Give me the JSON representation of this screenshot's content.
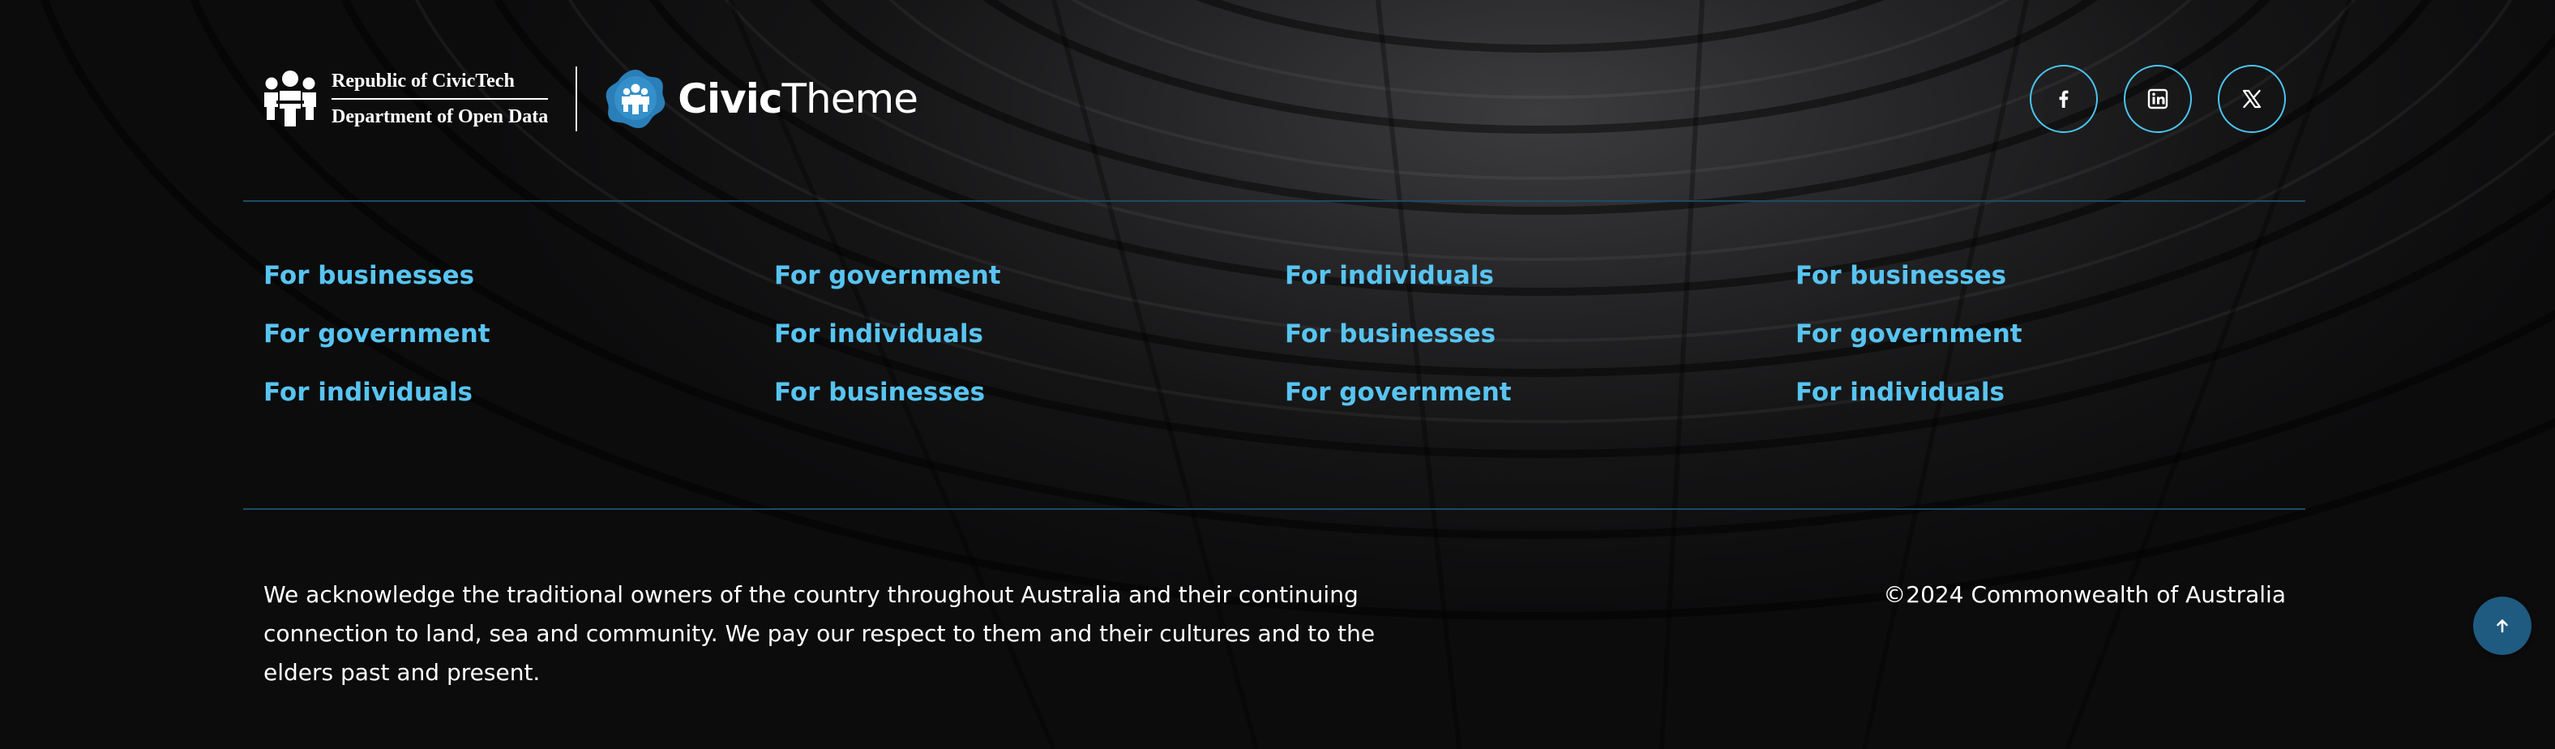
{
  "brand": {
    "gov_line1": "Republic of CivicTech",
    "gov_line2": "Department of Open Data",
    "civic_bold": "Civic",
    "civic_light": "Theme"
  },
  "social": [
    {
      "icon": "facebook-icon"
    },
    {
      "icon": "linkedin-icon"
    },
    {
      "icon": "x-twitter-icon"
    }
  ],
  "nav": {
    "col1": [
      "For businesses",
      "For government",
      "For individuals"
    ],
    "col2": [
      "For government",
      "For individuals",
      "For businesses"
    ],
    "col3": [
      "For individuals",
      "For businesses",
      "For government"
    ],
    "col4": [
      "For businesses",
      "For government",
      "For individuals"
    ]
  },
  "acknowledgement": "We acknowledge the traditional owners of the country throughout Australia and their continuing connection to land, sea and community. We pay our respect to them and their cultures and to the elders past and present.",
  "copyright": "©2024 Commonwealth of Australia",
  "back_to_top_icon": "arrow-up-icon",
  "colors": {
    "background": "#0b0b0c",
    "link": "#58c4f0",
    "social_border": "#4cc3ee",
    "divider": "#1e4a63",
    "back_to_top": "#1f5a80",
    "text": "#ffffff"
  }
}
